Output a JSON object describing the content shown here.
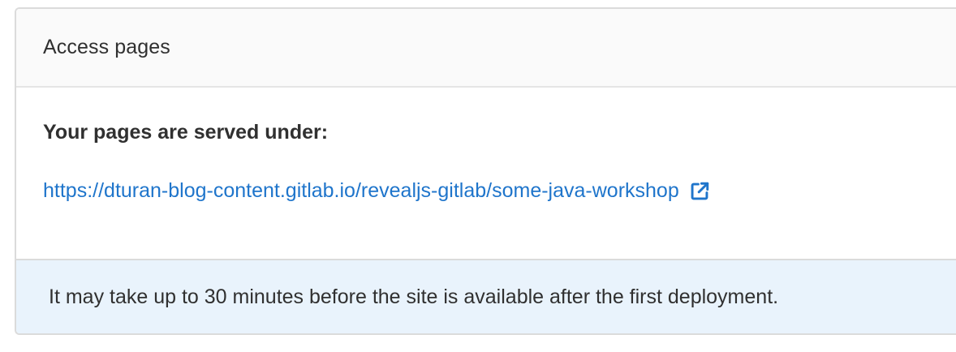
{
  "card": {
    "title": "Access pages",
    "served_label": "Your pages are served under:",
    "url": "https://dturan-blog-content.gitlab.io/revealjs-gitlab/some-java-workshop",
    "external_icon": "external-link-icon",
    "footer_note": "It may take up to 30 minutes before the site is available after the first deployment."
  },
  "colors": {
    "link": "#1f75cb",
    "footer_bg": "#e9f3fc",
    "header_bg": "#fafafa",
    "border": "#dbdbdb"
  }
}
